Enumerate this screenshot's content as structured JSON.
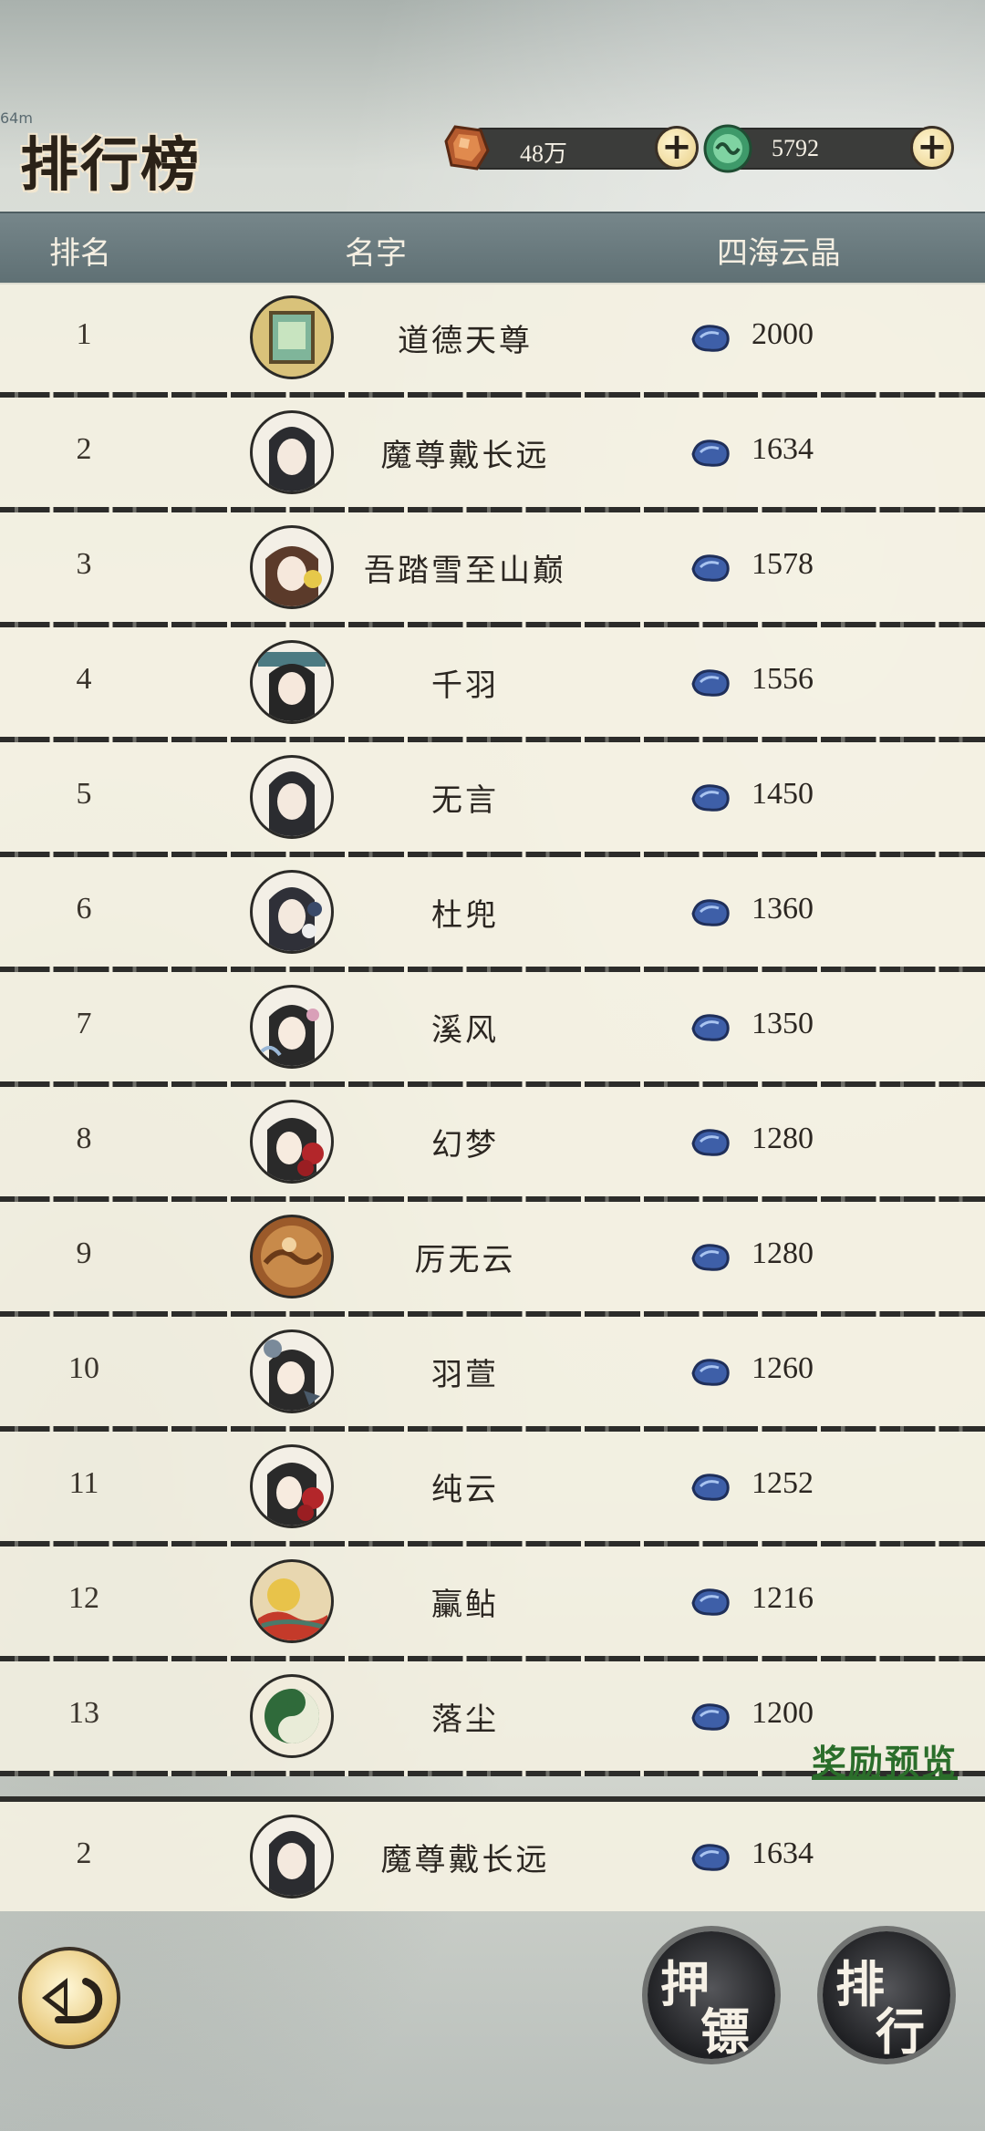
{
  "status_tag": "64m",
  "header": {
    "title": "排行榜",
    "gold_amount": "48万",
    "jade_amount": "5792",
    "add_gold_label": "+",
    "add_jade_label": "+"
  },
  "columns": {
    "rank": "排名",
    "name": "名字",
    "score": "四海云晶"
  },
  "rows": [
    {
      "rank": "1",
      "name": "道德天尊",
      "score": "2000",
      "avatar": "scroll-frame"
    },
    {
      "rank": "2",
      "name": "魔尊戴长远",
      "score": "1634",
      "avatar": "dark-hair-man"
    },
    {
      "rank": "3",
      "name": "吾踏雪至山巅",
      "score": "1578",
      "avatar": "mushroom-girl"
    },
    {
      "rank": "4",
      "name": "千羽",
      "score": "1556",
      "avatar": "hat-woman"
    },
    {
      "rank": "5",
      "name": "无言",
      "score": "1450",
      "avatar": "dark-hair-man"
    },
    {
      "rank": "6",
      "name": "杜兜",
      "score": "1360",
      "avatar": "flower-man"
    },
    {
      "rank": "7",
      "name": "溪风",
      "score": "1350",
      "avatar": "feather-woman"
    },
    {
      "rank": "8",
      "name": "幻梦",
      "score": "1280",
      "avatar": "rose-woman"
    },
    {
      "rank": "9",
      "name": "厉无云",
      "score": "1280",
      "avatar": "amber-frame"
    },
    {
      "rank": "10",
      "name": "羽萱",
      "score": "1260",
      "avatar": "bird-woman"
    },
    {
      "rank": "11",
      "name": "纯云",
      "score": "1252",
      "avatar": "rose-woman"
    },
    {
      "rank": "12",
      "name": "臝鲇",
      "score": "1216",
      "avatar": "moon-scene"
    },
    {
      "rank": "13",
      "name": "落尘",
      "score": "1200",
      "avatar": "green-gourd"
    }
  ],
  "my_rank": {
    "rank": "2",
    "name": "魔尊戴长远",
    "score": "1634",
    "avatar": "dark-hair-man"
  },
  "reward_preview_label": "奖励预览",
  "footer": {
    "back_icon": "back-arrow-icon",
    "escort_button": {
      "line1": "押",
      "line2": "镖"
    },
    "ranking_button": {
      "line1": "排",
      "line2": "行"
    }
  },
  "colors": {
    "accent_green": "#2b6e2b",
    "header_bar": "#6b7b7f",
    "crystal_blue": "#3e5fa8"
  }
}
